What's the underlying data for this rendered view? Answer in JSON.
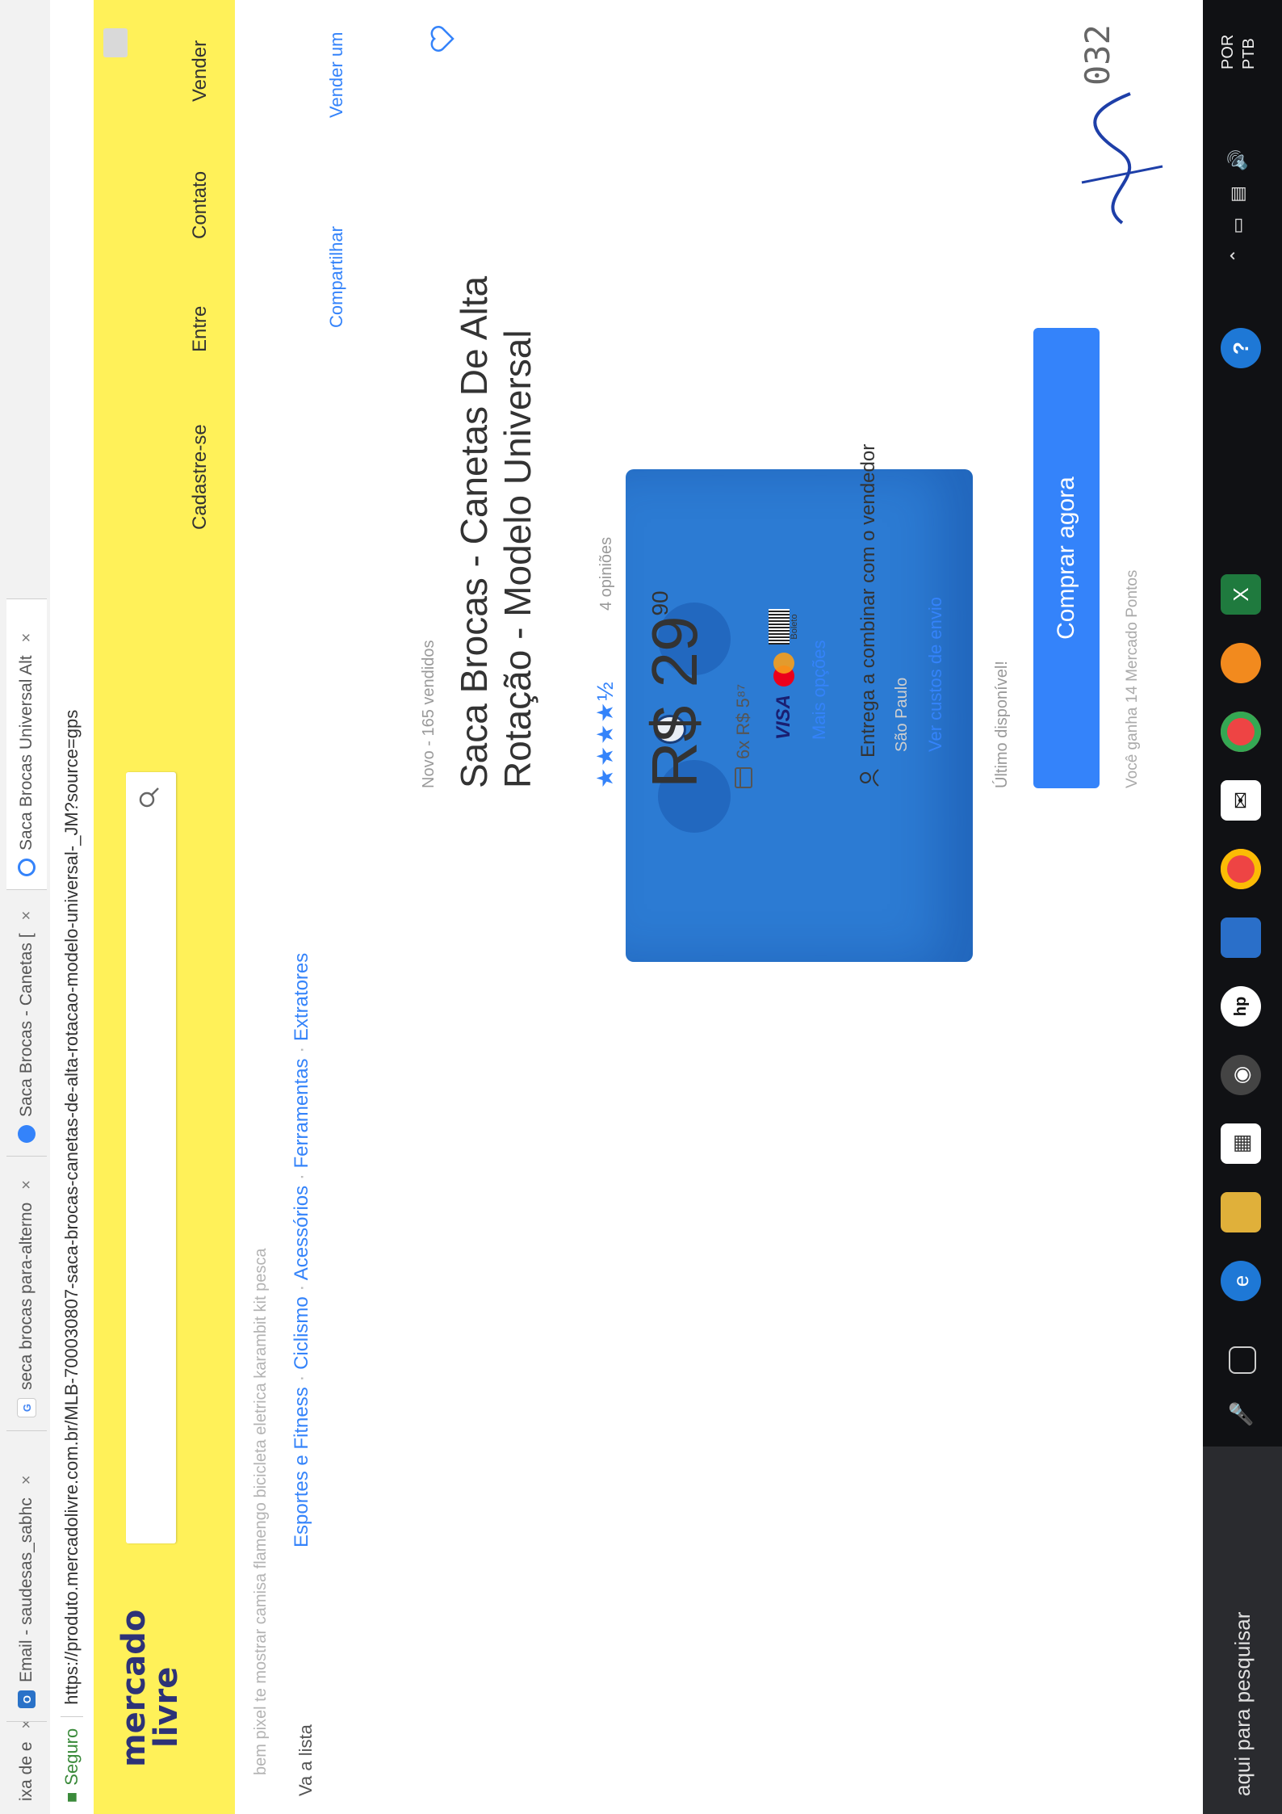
{
  "browser": {
    "tabs": [
      {
        "label": "ixa de e",
        "color": "#9aa"
      },
      {
        "label": "Email - saudesas_sabhc",
        "color": "#2a72c8"
      },
      {
        "label": "seca brocas para-alterno",
        "color": "#4285f4"
      },
      {
        "label": "Saca Brocas - Canetas [",
        "color": "#3483fa"
      },
      {
        "label": "Saca Brocas Universal Alt",
        "color": "#3483fa"
      }
    ],
    "tab_close": "×",
    "secure_label": "Seguro",
    "url": "https://produto.mercadolivre.com.br/MLB-700030807-saca-brocas-canetas-de-alta-rotacao-modelo-universal-_JM?source=gps"
  },
  "header": {
    "logo_line1": "mercado",
    "logo_line2": "livre",
    "nav": [
      "Cadastre-se",
      "Entre",
      "Contato",
      "Vender"
    ]
  },
  "page": {
    "suggestions": "bem pixel te mostrar camisa flamengo bicicleta eletrica karambit kit pesca",
    "back": "Va a lista",
    "breadcrumbs": [
      "Esportes e Fitness",
      "Ciclismo",
      "Acessórios",
      "Ferramentas",
      "Extratores"
    ],
    "share": "Compartilhar",
    "sell_one": "Vender um"
  },
  "product": {
    "condition": "Novo - 165 vendidos",
    "title": "Saca Brocas - Canetas De Alta Rotação - Modelo Universal",
    "stars": "★★★★½",
    "rating": 4.5,
    "reviews": "4 opiniões",
    "currency": "R$",
    "price_int": "29",
    "price_cents": "90",
    "installments": "6x R$ 5⁸⁷",
    "card_visa": "VISA",
    "card_boleto": "Boleto",
    "more_options": "Mais opções",
    "shipping": "Entrega a combinar com o vendedor",
    "shipping_city": "São Paulo",
    "shipping_link": "Ver custos de envio",
    "stock": "Último disponível!",
    "buy_button": "Comprar agora",
    "points": "Você ganha 14 Mercado Pontos"
  },
  "annotation": {
    "handwritten_number": "032"
  },
  "taskbar": {
    "search_text": "aqui para pesquisar",
    "language_line1": "POR",
    "language_line2": "PTB"
  },
  "colors": {
    "brand_yellow": "#fff159",
    "accent_blue": "#3483fa",
    "taskbar": "#101114"
  }
}
